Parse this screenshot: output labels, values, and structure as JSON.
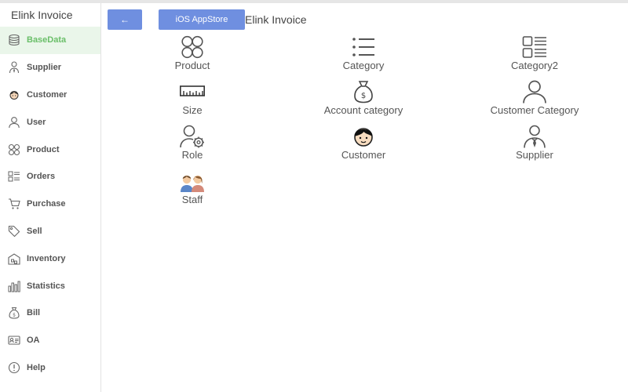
{
  "sidebar": {
    "app_title": "Elink Invoice",
    "items": [
      {
        "label": "BaseData",
        "icon": "database-icon"
      },
      {
        "label": "Supplier",
        "icon": "supplier-icon"
      },
      {
        "label": "Customer",
        "icon": "customer-icon"
      },
      {
        "label": "User",
        "icon": "user-icon"
      },
      {
        "label": "Product",
        "icon": "product-icon"
      },
      {
        "label": "Orders",
        "icon": "orders-icon"
      },
      {
        "label": "Purchase",
        "icon": "cart-icon"
      },
      {
        "label": "Sell",
        "icon": "tag-icon"
      },
      {
        "label": "Inventory",
        "icon": "warehouse-icon"
      },
      {
        "label": "Statistics",
        "icon": "statistics-icon"
      },
      {
        "label": "Bill",
        "icon": "money-bag-icon"
      },
      {
        "label": "OA",
        "icon": "id-card-icon"
      },
      {
        "label": "Help",
        "icon": "help-icon"
      }
    ]
  },
  "header": {
    "back_label": "←",
    "store_label": "iOS AppStore",
    "title": "Elink Invoice"
  },
  "tiles": [
    {
      "label": "Product",
      "icon": "product-icon"
    },
    {
      "label": "Category",
      "icon": "list-icon"
    },
    {
      "label": "Category2",
      "icon": "category2-icon"
    },
    {
      "label": "Size",
      "icon": "ruler-icon"
    },
    {
      "label": "Account category",
      "icon": "money-bag-icon"
    },
    {
      "label": "Customer Category",
      "icon": "person-icon"
    },
    {
      "label": "Role",
      "icon": "user-settings-icon"
    },
    {
      "label": "Customer",
      "icon": "customer-icon"
    },
    {
      "label": "Supplier",
      "icon": "supplier-icon"
    },
    {
      "label": "Staff",
      "icon": "staff-icon"
    }
  ],
  "colors": {
    "accent": "#6f8fe0",
    "active_text": "#6abf69",
    "active_bg": "#eaf6ea"
  }
}
